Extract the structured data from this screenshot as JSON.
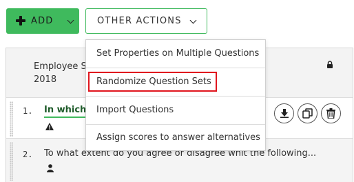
{
  "toolbar": {
    "add_label": "ADD",
    "other_actions_label": "OTHER ACTIONS"
  },
  "table": {
    "header_title_line1": "Employee S",
    "header_title_line2": "2018",
    "rows": [
      {
        "number": "1.",
        "text": "In which c"
      },
      {
        "number": "2.",
        "text": "To what extent do you agree or disagree whit the following..."
      }
    ]
  },
  "menu": {
    "items": [
      {
        "label": "Set Properties on Multiple Questions"
      },
      {
        "label": "Randomize Question Sets"
      },
      {
        "label": "Import Questions"
      },
      {
        "label": "Assign scores to answer alternatives"
      }
    ],
    "highlighted_index": 1
  },
  "colors": {
    "accent_green": "#3fba5d",
    "highlight_red": "#e0161e"
  },
  "icons": [
    "plus-icon",
    "chevron-down-icon",
    "lock-icon",
    "warning-icon",
    "person-icon",
    "download-icon",
    "copy-icon",
    "trash-icon"
  ]
}
